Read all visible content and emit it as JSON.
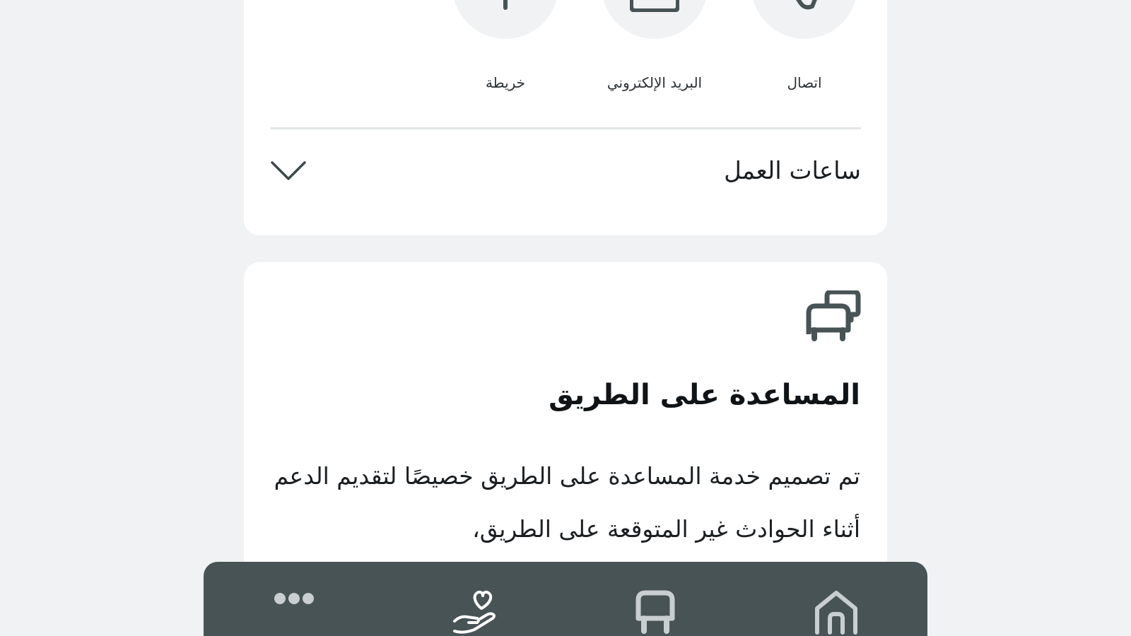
{
  "contact": {
    "actions": [
      {
        "label": "اتصال",
        "icon": "phone-icon"
      },
      {
        "label": "البريد الإلكتروني",
        "icon": "mail-icon"
      },
      {
        "label": "خريطة",
        "icon": "map-pin-icon"
      }
    ],
    "hours_label": "ساعات العمل",
    "hours_icon": "chevron-down-icon"
  },
  "assistance": {
    "icon": "vehicles-icon",
    "title": "المساعدة على الطريق",
    "body": "تم تصميم خدمة المساعدة على الطريق خصيصًا لتقديم الدعم أثناء الحوادث غير المتوقعة على الطريق،"
  },
  "bottom_nav": {
    "items": [
      {
        "name": "more",
        "icon": "more-icon"
      },
      {
        "name": "care",
        "icon": "hand-heart-icon"
      },
      {
        "name": "vehicle",
        "icon": "car-icon"
      },
      {
        "name": "home",
        "icon": "home-icon"
      }
    ]
  },
  "colors": {
    "background": "#f0f2f3",
    "card": "#ffffff",
    "nav": "#485356",
    "icon": "#485356"
  }
}
